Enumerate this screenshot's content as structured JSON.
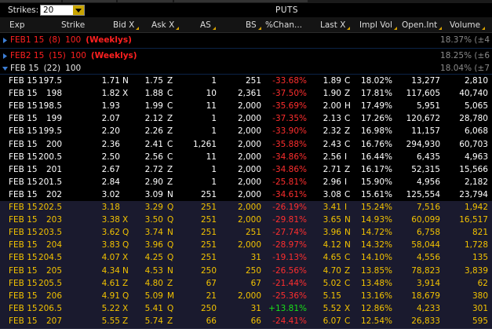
{
  "strikes": {
    "label": "Strikes:",
    "value": "20"
  },
  "panel_title": "PUTS",
  "columns": [
    "Exp",
    "Strike",
    "Bid X",
    "Ask X",
    "AS",
    "BS",
    "%Chan...",
    "Last X",
    "Impl Vol",
    "Open.Int",
    "Volume"
  ],
  "groups": [
    {
      "exp": "FEB1 15",
      "days": "(8)",
      "mult": "100",
      "tag": "(Weeklys)",
      "right": "18.37% (±4",
      "expanded": false
    },
    {
      "exp": "FEB2 15",
      "days": "(15)",
      "mult": "100",
      "tag": "(Weeklys)",
      "right": "18.25% (±6",
      "expanded": false
    },
    {
      "exp": "FEB 15",
      "days": "(22)",
      "mult": "100",
      "tag": "",
      "right": "18.04% (±7",
      "expanded": true
    }
  ],
  "rows": [
    {
      "exp": "FEB 15",
      "strike": "197.5",
      "bid": "1.71",
      "bidx": "N",
      "ask": "1.75",
      "askx": "Z",
      "as": "1",
      "bs": "251",
      "chg": "-33.68%",
      "last": "1.89",
      "lastx": "C",
      "iv": "18.02%",
      "oi": "13,277",
      "vol": "2,810"
    },
    {
      "exp": "FEB 15",
      "strike": "198",
      "bid": "1.82",
      "bidx": "X",
      "ask": "1.88",
      "askx": "C",
      "as": "10",
      "bs": "2,361",
      "chg": "-37.50%",
      "last": "1.90",
      "lastx": "Z",
      "iv": "17.81%",
      "oi": "117,605",
      "vol": "40,740"
    },
    {
      "exp": "FEB 15",
      "strike": "198.5",
      "bid": "1.93",
      "bidx": "",
      "ask": "1.99",
      "askx": "C",
      "as": "11",
      "bs": "2,000",
      "chg": "-35.69%",
      "last": "2.00",
      "lastx": "H",
      "iv": "17.49%",
      "oi": "5,951",
      "vol": "5,065"
    },
    {
      "exp": "FEB 15",
      "strike": "199",
      "bid": "2.07",
      "bidx": "",
      "ask": "2.12",
      "askx": "Z",
      "as": "1",
      "bs": "2,000",
      "chg": "-37.35%",
      "last": "2.13",
      "lastx": "C",
      "iv": "17.26%",
      "oi": "120,672",
      "vol": "28,780"
    },
    {
      "exp": "FEB 15",
      "strike": "199.5",
      "bid": "2.20",
      "bidx": "",
      "ask": "2.26",
      "askx": "Z",
      "as": "1",
      "bs": "2,000",
      "chg": "-33.90%",
      "last": "2.32",
      "lastx": "Z",
      "iv": "16.98%",
      "oi": "11,157",
      "vol": "6,068"
    },
    {
      "exp": "FEB 15",
      "strike": "200",
      "bid": "2.36",
      "bidx": "",
      "ask": "2.41",
      "askx": "C",
      "as": "1,261",
      "bs": "2,000",
      "chg": "-35.88%",
      "last": "2.43",
      "lastx": "C",
      "iv": "16.76%",
      "oi": "294,930",
      "vol": "60,703"
    },
    {
      "exp": "FEB 15",
      "strike": "200.5",
      "bid": "2.50",
      "bidx": "",
      "ask": "2.56",
      "askx": "C",
      "as": "11",
      "bs": "2,000",
      "chg": "-34.86%",
      "last": "2.56",
      "lastx": "I",
      "iv": "16.44%",
      "oi": "6,435",
      "vol": "4,963"
    },
    {
      "exp": "FEB 15",
      "strike": "201",
      "bid": "2.67",
      "bidx": "",
      "ask": "2.72",
      "askx": "Z",
      "as": "1",
      "bs": "2,000",
      "chg": "-34.86%",
      "last": "2.71",
      "lastx": "Z",
      "iv": "16.17%",
      "oi": "52,315",
      "vol": "15,566"
    },
    {
      "exp": "FEB 15",
      "strike": "201.5",
      "bid": "2.84",
      "bidx": "",
      "ask": "2.90",
      "askx": "Z",
      "as": "1",
      "bs": "2,000",
      "chg": "-25.81%",
      "last": "2.96",
      "lastx": "I",
      "iv": "15.90%",
      "oi": "4,956",
      "vol": "2,182"
    },
    {
      "exp": "FEB 15",
      "strike": "202",
      "bid": "3.02",
      "bidx": "",
      "ask": "3.09",
      "askx": "N",
      "as": "251",
      "bs": "2,000",
      "chg": "-34.61%",
      "last": "3.08",
      "lastx": "C",
      "iv": "15.61%",
      "oi": "125,554",
      "vol": "23,794"
    },
    {
      "exp": "FEB 15",
      "strike": "202.5",
      "bid": "3.18",
      "bidx": "",
      "ask": "3.29",
      "askx": "Q",
      "as": "251",
      "bs": "2,000",
      "chg": "-26.19%",
      "last": "3.41",
      "lastx": "I",
      "iv": "15.24%",
      "oi": "7,516",
      "vol": "1,942"
    },
    {
      "exp": "FEB 15",
      "strike": "203",
      "bid": "3.38",
      "bidx": "X",
      "ask": "3.50",
      "askx": "Q",
      "as": "251",
      "bs": "2,000",
      "chg": "-29.81%",
      "last": "3.65",
      "lastx": "N",
      "iv": "14.93%",
      "oi": "60,099",
      "vol": "16,517"
    },
    {
      "exp": "FEB 15",
      "strike": "203.5",
      "bid": "3.62",
      "bidx": "Q",
      "ask": "3.74",
      "askx": "N",
      "as": "251",
      "bs": "251",
      "chg": "-27.74%",
      "last": "3.96",
      "lastx": "N",
      "iv": "14.72%",
      "oi": "6,758",
      "vol": "821"
    },
    {
      "exp": "FEB 15",
      "strike": "204",
      "bid": "3.83",
      "bidx": "Q",
      "ask": "3.96",
      "askx": "Q",
      "as": "251",
      "bs": "2,000",
      "chg": "-28.97%",
      "last": "4.12",
      "lastx": "N",
      "iv": "14.32%",
      "oi": "58,044",
      "vol": "1,728"
    },
    {
      "exp": "FEB 15",
      "strike": "204.5",
      "bid": "4.07",
      "bidx": "X",
      "ask": "4.25",
      "askx": "Q",
      "as": "251",
      "bs": "31",
      "chg": "-19.13%",
      "last": "4.65",
      "lastx": "C",
      "iv": "14.10%",
      "oi": "4,556",
      "vol": "135"
    },
    {
      "exp": "FEB 15",
      "strike": "205",
      "bid": "4.34",
      "bidx": "N",
      "ask": "4.53",
      "askx": "N",
      "as": "250",
      "bs": "250",
      "chg": "-26.56%",
      "last": "4.70",
      "lastx": "Z",
      "iv": "13.85%",
      "oi": "78,823",
      "vol": "3,839"
    },
    {
      "exp": "FEB 15",
      "strike": "205.5",
      "bid": "4.61",
      "bidx": "Z",
      "ask": "4.80",
      "askx": "Z",
      "as": "67",
      "bs": "67",
      "chg": "-21.44%",
      "last": "5.02",
      "lastx": "C",
      "iv": "13.48%",
      "oi": "3,914",
      "vol": "62"
    },
    {
      "exp": "FEB 15",
      "strike": "206",
      "bid": "4.91",
      "bidx": "Q",
      "ask": "5.09",
      "askx": "M",
      "as": "21",
      "bs": "2,000",
      "chg": "-25.36%",
      "last": "5.15",
      "lastx": "",
      "iv": "13.16%",
      "oi": "18,679",
      "vol": "380"
    },
    {
      "exp": "FEB 15",
      "strike": "206.5",
      "bid": "5.22",
      "bidx": "X",
      "ask": "5.41",
      "askx": "Q",
      "as": "250",
      "bs": "31",
      "chg": "+13.81%",
      "last": "5.52",
      "lastx": "X",
      "iv": "12.86%",
      "oi": "4,233",
      "vol": "301"
    },
    {
      "exp": "FEB 15",
      "strike": "207",
      "bid": "5.55",
      "bidx": "Z",
      "ask": "5.74",
      "askx": "Z",
      "as": "66",
      "bs": "66",
      "chg": "-24.41%",
      "last": "6.07",
      "lastx": "C",
      "iv": "12.54%",
      "oi": "26,833",
      "vol": "595"
    }
  ],
  "colors": {
    "itm_bg": "#000000",
    "otm_bg": "#1a1a2e",
    "otm_text": "#f2c200",
    "itm_text": "#ffffff",
    "neg": "#ff2e2e",
    "pos": "#18e018",
    "group_red": "#ff2020",
    "expand_blue": "#3d7fd6"
  }
}
